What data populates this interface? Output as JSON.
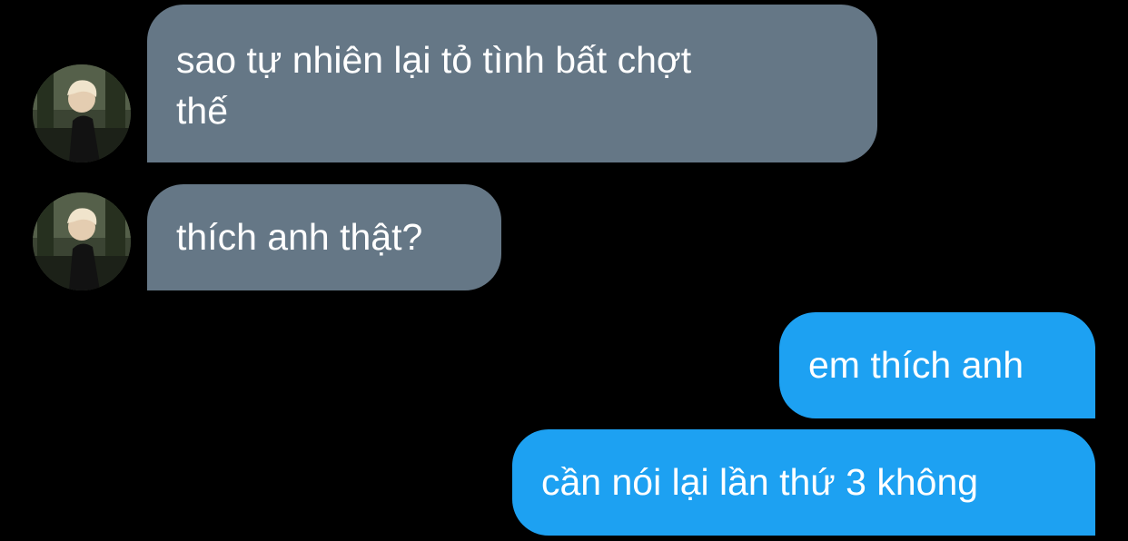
{
  "conversation": {
    "messages": [
      {
        "sender": "them",
        "text": "sao tự nhiên lại tỏ tình bất chợt\nthế"
      },
      {
        "sender": "them",
        "text": "thích anh thật?"
      },
      {
        "sender": "me",
        "text": "em thích anh"
      },
      {
        "sender": "me",
        "text": "cần nói lại lần thứ 3 không"
      }
    ]
  },
  "colors": {
    "background": "#000000",
    "incoming_bubble": "#657786",
    "outgoing_bubble": "#1da1f2",
    "text": "#ffffff"
  },
  "icons": {
    "avatar": "user-avatar-photo"
  }
}
